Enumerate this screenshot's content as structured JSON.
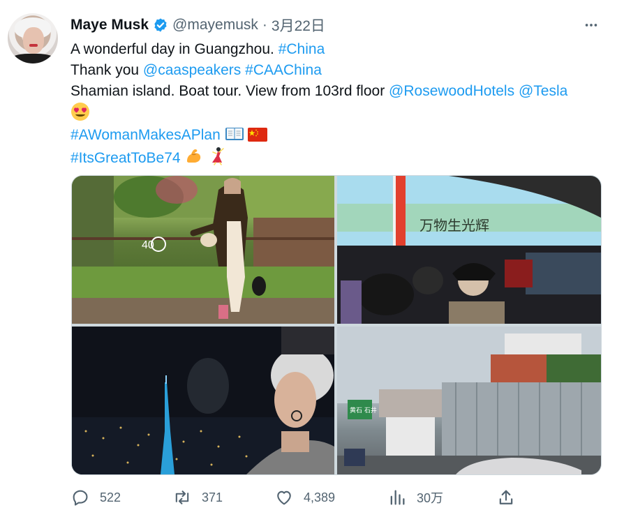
{
  "author": {
    "name": "Maye Musk",
    "handle": "@mayemusk",
    "separator": "·",
    "date": "3月22日"
  },
  "tweet": {
    "line1_text": "A wonderful day in Guangzhou. ",
    "line1_tag": "#China",
    "line2_text": "Thank you ",
    "line2_mention": "@caaspeakers",
    "line2_tag": "#CAAChina",
    "line3_text": "Shamian island. Boat tour. View from 103rd floor ",
    "line3_mention1": "@RosewoodHotels",
    "line3_mention2": "@Tesla",
    "line5_tag": "#AWomanMakesAPlan",
    "line6_tag": "#ItsGreatToBe74"
  },
  "media_overlay_text": {
    "building_logo": "40",
    "screen_chars": "万物生光辉",
    "sign_text": "黄石 石井"
  },
  "actions": {
    "reply_count": "522",
    "retweet_count": "371",
    "like_count": "4,389",
    "views_count": "30万"
  },
  "colors": {
    "accent": "#1d9bf0",
    "text": "#0f1419",
    "secondary": "#536471"
  },
  "icons": {
    "verified": "verified-badge-icon",
    "more": "more-options-icon",
    "reply": "reply-icon",
    "retweet": "retweet-icon",
    "like": "heart-icon",
    "views": "analytics-icon",
    "share": "share-icon"
  }
}
